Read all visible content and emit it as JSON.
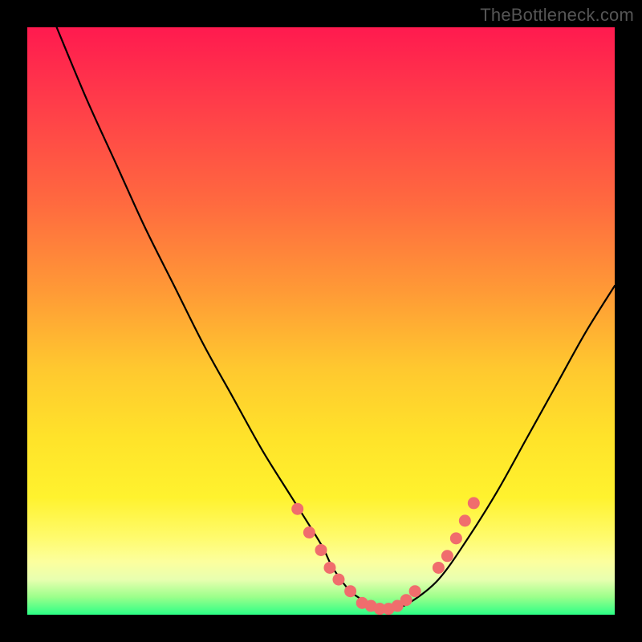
{
  "watermark": "TheBottleneck.com",
  "chart_data": {
    "type": "line",
    "title": "",
    "xlabel": "",
    "ylabel": "",
    "xlim": [
      0,
      100
    ],
    "ylim": [
      0,
      100
    ],
    "series": [
      {
        "name": "bottleneck-curve",
        "x": [
          5,
          10,
          15,
          20,
          25,
          30,
          35,
          40,
          45,
          50,
          52,
          55,
          58,
          60,
          62,
          65,
          70,
          75,
          80,
          85,
          90,
          95,
          100
        ],
        "values": [
          100,
          88,
          77,
          66,
          56,
          46,
          37,
          28,
          20,
          12,
          8,
          4,
          2,
          1,
          1,
          2,
          6,
          13,
          21,
          30,
          39,
          48,
          56
        ]
      }
    ],
    "markers": {
      "name": "highlighted-points",
      "color": "#f06d6d",
      "points": [
        {
          "x": 46,
          "y": 18
        },
        {
          "x": 48,
          "y": 14
        },
        {
          "x": 50,
          "y": 11
        },
        {
          "x": 51.5,
          "y": 8
        },
        {
          "x": 53,
          "y": 6
        },
        {
          "x": 55,
          "y": 4
        },
        {
          "x": 57,
          "y": 2
        },
        {
          "x": 58.5,
          "y": 1.5
        },
        {
          "x": 60,
          "y": 1
        },
        {
          "x": 61.5,
          "y": 1
        },
        {
          "x": 63,
          "y": 1.5
        },
        {
          "x": 64.5,
          "y": 2.5
        },
        {
          "x": 66,
          "y": 4
        },
        {
          "x": 70,
          "y": 8
        },
        {
          "x": 71.5,
          "y": 10
        },
        {
          "x": 73,
          "y": 13
        },
        {
          "x": 74.5,
          "y": 16
        },
        {
          "x": 76,
          "y": 19
        }
      ]
    },
    "background_gradient": {
      "top": "#ff1a4f",
      "mid": "#ffe32a",
      "bottom": "#2cff86"
    }
  }
}
